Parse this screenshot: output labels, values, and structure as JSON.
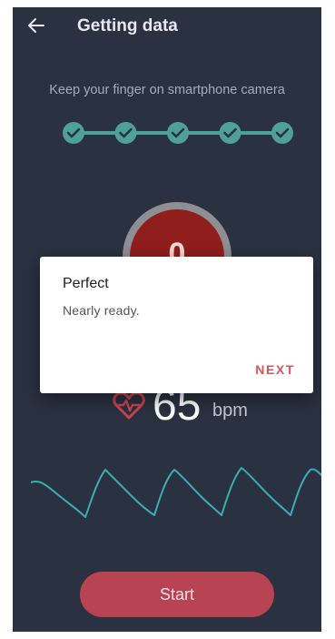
{
  "header": {
    "title": "Getting data",
    "back_icon": "arrow-left-icon"
  },
  "instruction": "Keep your finger on smartphone camera",
  "progress": {
    "total_steps": 5,
    "completed_steps": 5,
    "step_icon": "check-icon",
    "color": "#4fa098"
  },
  "finger_circle": {
    "countdown": "0"
  },
  "heart_rate": {
    "value": "65",
    "unit": "bpm",
    "icon": "heart-icon",
    "accent_color": "#c8434f"
  },
  "waveform": {
    "color": "#3aaeb0"
  },
  "start_button": {
    "label": "Start",
    "color": "#b84352"
  },
  "dialog": {
    "title": "Perfect",
    "message": "Nearly ready.",
    "action_label": "NEXT",
    "action_color": "#d6535f"
  },
  "colors": {
    "background": "#2a3140"
  }
}
